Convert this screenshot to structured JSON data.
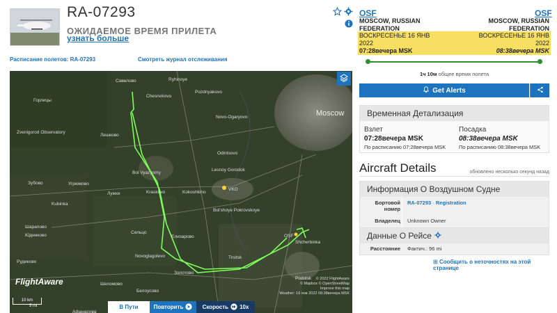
{
  "header": {
    "tail_number": "RA-07293",
    "status": "ОЖИДАЕМОЕ ВРЕМЯ ПРИЛЕТА",
    "learn_more": "узнать больше",
    "schedule_link": "Расписание полетов: RA-07293",
    "track_log_link": "Смотреть журнал отслеживания"
  },
  "route": {
    "origin": {
      "code": "OSF",
      "city1": "MOSCOW, RUSSIAN",
      "city2": "FEDERATION",
      "date1": "ВОСКРЕСЕНЬЕ 16 ЯНВ",
      "date2": "2022",
      "time": "07:28вечера MSK"
    },
    "destination": {
      "code": "OSF",
      "city1": "MOSCOW, RUSSIAN",
      "city2": "FEDERATION",
      "date1": "ВОСКРЕСЕНЬЕ 16 ЯНВ",
      "date2": "2022",
      "time": "08:38вечера MSK"
    },
    "total_time_value": "1ч 10м",
    "total_time_label": "общее время полета",
    "progress": 1.0
  },
  "actions": {
    "get_alerts": "Get Alerts"
  },
  "time_detail": {
    "title": "Временная Детализация",
    "departure_label": "Взлет",
    "departure_time": "07:28вечера MSK",
    "departure_scheduled": "По расписанию 07:28вечера MSK",
    "arrival_label": "Посадка",
    "arrival_time": "08:38вечера MSK",
    "arrival_scheduled": "По расписанию 08:38вечера MSK"
  },
  "aircraft": {
    "title": "Aircraft Details",
    "updated": "обновлено несколько секунд назад",
    "info_title": "Информация О Воздушном Судне",
    "tail_label": "Бортовой номер",
    "tail_value": "RA-07293",
    "registration": "Registration",
    "owner_label": "Владелец",
    "owner_value": "Unknown Owner"
  },
  "flight_data": {
    "title": "Данные О Рейсе",
    "distance_label": "Расстояние",
    "distance_value": "Фактич.: 96 mi"
  },
  "corrections": "Сообщить о неточностях на этой странице",
  "map": {
    "labels": [
      "Савелово",
      "Chesnokovo",
      "Pozdnyakovo",
      "Moscow",
      "Novo-Ogaryovo",
      "Zvenigorod Observatory",
      "Odintsovo",
      "Лешково",
      "Lesnoy Gorodok",
      "Bol Vyazyomy",
      "Kraskovo",
      "Kokoshkino",
      "VKO",
      "Bol'shoye Pokrovskoye",
      "Сельцо",
      "Novoglagolevo",
      "Troitsk",
      "Елизарово",
      "Shcherbinka",
      "Podolsk",
      "Белоусово",
      "Шеломово",
      "Рудиково",
      "Афанасова",
      "Лужки",
      "Угрюмово",
      "Зубово",
      "Шарапово",
      "Kubinka",
      "Юдинково",
      "Горлицы",
      "Ryhinoye",
      "Золотово"
    ],
    "airport_label": "VKO",
    "osf_label": "OSF",
    "brand": "FlightAware",
    "scale_km": "10 km",
    "scale_mi": "5 mi",
    "attribution": [
      "© 2022 FlightAware",
      "© Mapbox © OpenStreetMap",
      "Improve this map",
      "Weather: 16 янв 2022 08:38вечера MSK"
    ],
    "en_route": "В Пути",
    "replay": "Повторить",
    "speed_label": "Скорость",
    "speed_value": "10x"
  },
  "colors": {
    "accent": "#1e73be",
    "highlight": "#f7df61",
    "route": "#2d8f2d",
    "track": "#7dff5a"
  },
  "icons": [
    "star-icon",
    "gear-icon",
    "info-icon",
    "bell-icon",
    "share-icon",
    "layers-icon",
    "play-icon",
    "fast-forward-icon"
  ]
}
